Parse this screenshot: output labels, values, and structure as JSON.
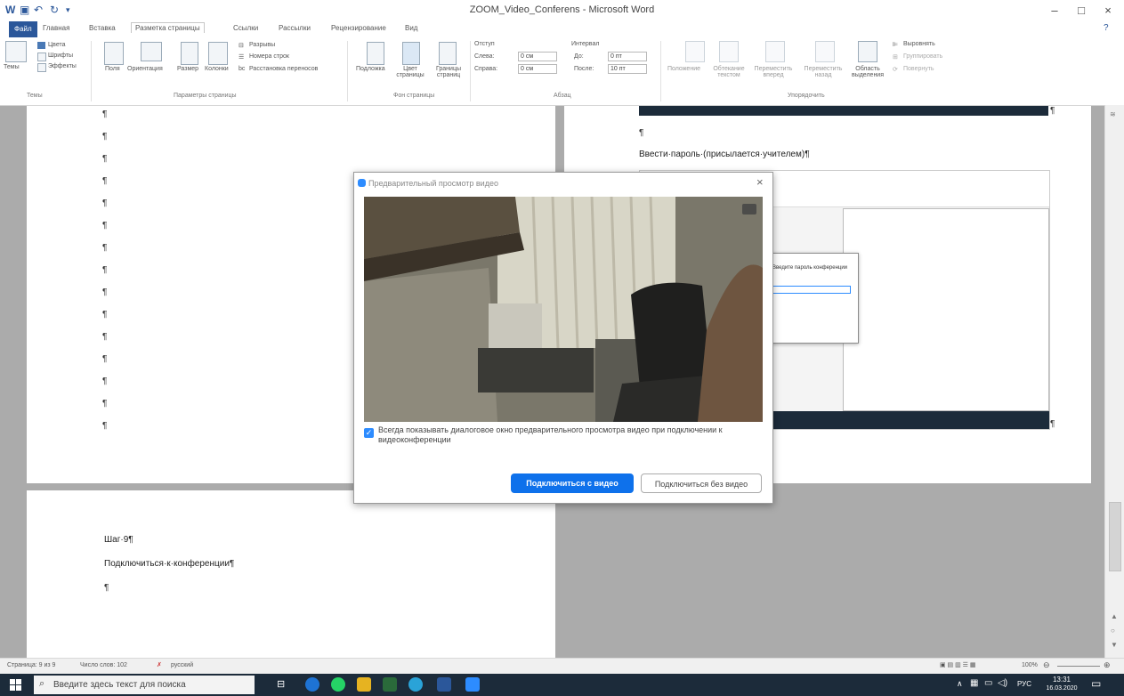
{
  "window": {
    "title": "ZOOM_Video_Conferens - Microsoft Word",
    "minimize": "–",
    "maximize": "□",
    "close": "×"
  },
  "tabs": [
    "Файл",
    "Главная",
    "Вставка",
    "Разметка страницы",
    "Ссылки",
    "Рассылки",
    "Рецензирование",
    "Вид"
  ],
  "ribbon": {
    "themes": {
      "themes": "Темы",
      "colors": "Цвета",
      "fonts": "Шрифты",
      "effects": "Эффекты",
      "group": "Темы"
    },
    "page_setup": {
      "margins": "Поля",
      "orientation": "Ориентация",
      "size": "Размер",
      "columns": "Колонки",
      "breaks": "Разрывы",
      "line_numbers": "Номера строк",
      "hyphenation": "Расстановка переносов",
      "group": "Параметры страницы"
    },
    "background": {
      "watermark": "Подложка",
      "color": "Цвет страницы",
      "borders": "Границы страниц",
      "group": "Фон страницы"
    },
    "paragraph": {
      "indent": "Отступ",
      "left": "Слева:",
      "left_val": "0 см",
      "right": "Справа:",
      "right_val": "0 см",
      "spacing": "Интервал",
      "before": "До:",
      "before_val": "0 пт",
      "after": "После:",
      "after_val": "10 пт",
      "group": "Абзац"
    },
    "arrange": {
      "position": "Положение",
      "wrap": "Обтекание текстом",
      "forward": "Переместить вперед",
      "backward": "Переместить назад",
      "selection": "Область выделения",
      "align": "Выровнять",
      "group_btn": "Группировать",
      "rotate": "Повернуть",
      "group": "Упорядочить"
    }
  },
  "document": {
    "mark": "¶",
    "right_page_line": "Ввести·пароль·(присылается·учителем)¶",
    "step_label": "Шаг·9¶",
    "step_text": "Подключиться·к·конференции¶"
  },
  "embedded": {
    "password_title": "Введите пароль конференции"
  },
  "dialog": {
    "title": "Предварительный просмотр видео",
    "close": "×",
    "checkbox_checked": true,
    "checkbox_label": "Всегда показывать диалоговое окно предварительного просмотра видео при подключении к видеоконференции",
    "join_with_video": "Подключиться с видео",
    "join_without_video": "Подключиться без видео"
  },
  "status_bar": {
    "page": "Страница: 9 из 9",
    "words": "Число слов: 102",
    "language": "русский",
    "zoom": "100%"
  },
  "taskbar": {
    "search_placeholder": "Введите здесь текст для поиска",
    "lang": "РУС",
    "time": "13:31",
    "date": "16.03.2020"
  },
  "colors": {
    "word_blue": "#2b579a",
    "zoom_blue": "#0e71eb",
    "taskbar": "#1c2b3a"
  }
}
